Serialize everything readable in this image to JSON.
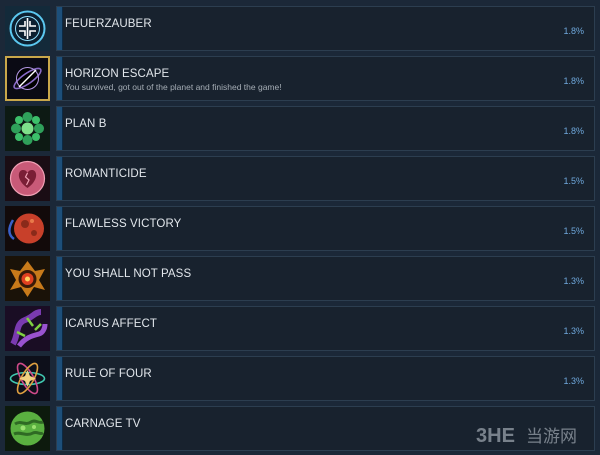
{
  "achievements": [
    {
      "id": "feuerzauber",
      "title": "FEUERZAUBER",
      "description": "",
      "percent": "1.8%",
      "icon": "blue-rune-circle-icon",
      "unlocked": false,
      "colors": {
        "bg": "#132a3a",
        "main": "#5bc8f0",
        "accent": "#ffffff"
      }
    },
    {
      "id": "horizon-escape",
      "title": "HORIZON ESCAPE",
      "description": "You survived, got out of the planet and finished the game!",
      "percent": "1.8%",
      "icon": "black-hole-planet-icon",
      "unlocked": true,
      "colors": {
        "bg": "#0a0a14",
        "main": "#8a6bc8",
        "accent": "#ffffff"
      }
    },
    {
      "id": "plan-b",
      "title": "PLAN B",
      "description": "",
      "percent": "1.8%",
      "icon": "green-spore-cluster-icon",
      "unlocked": false,
      "colors": {
        "bg": "#0d1a14",
        "main": "#2fa05a",
        "accent": "#7ee08a"
      }
    },
    {
      "id": "romanticide",
      "title": "ROMANTICIDE",
      "description": "",
      "percent": "1.5%",
      "icon": "broken-heart-icon",
      "unlocked": false,
      "colors": {
        "bg": "#1a0d14",
        "main": "#c85a78",
        "accent": "#f0a0b4"
      }
    },
    {
      "id": "flawless-victory",
      "title": "FLAWLESS VICTORY",
      "description": "",
      "percent": "1.5%",
      "icon": "red-planet-icon",
      "unlocked": false,
      "colors": {
        "bg": "#120a0a",
        "main": "#c8402a",
        "accent": "#3a60c8"
      }
    },
    {
      "id": "you-shall-not-pass",
      "title": "YOU SHALL NOT PASS",
      "description": "",
      "percent": "1.3%",
      "icon": "fire-eye-emblem-icon",
      "unlocked": false,
      "colors": {
        "bg": "#1a1208",
        "main": "#c87a1a",
        "accent": "#e04020"
      }
    },
    {
      "id": "icarus-affect",
      "title": "ICARUS AFFECT",
      "description": "",
      "percent": "1.3%",
      "icon": "purple-tentacle-icon",
      "unlocked": false,
      "colors": {
        "bg": "#1a0d24",
        "main": "#7a3ab0",
        "accent": "#7fd040"
      }
    },
    {
      "id": "rule-of-four",
      "title": "RULE OF FOUR",
      "description": "",
      "percent": "1.3%",
      "icon": "atom-star-icon",
      "unlocked": false,
      "colors": {
        "bg": "#0d0f1a",
        "main": "#d04a8a",
        "accent": "#40c8b0"
      }
    },
    {
      "id": "carnage-tv",
      "title": "CARNAGE TV",
      "description": "",
      "percent": "",
      "icon": "green-globe-icon",
      "unlocked": false,
      "colors": {
        "bg": "#0d1a0d",
        "main": "#5ab040",
        "accent": "#9ae070"
      }
    }
  ],
  "watermark": {
    "logo": "3HE",
    "text": "当游网"
  },
  "theme": {
    "background": "#1b2838",
    "bar": "#18222e",
    "accent": "#1d4f7a",
    "title_color": "#e2e7ec",
    "percent_color": "#6fa8dc",
    "gold_frame": "#c9a74a"
  }
}
